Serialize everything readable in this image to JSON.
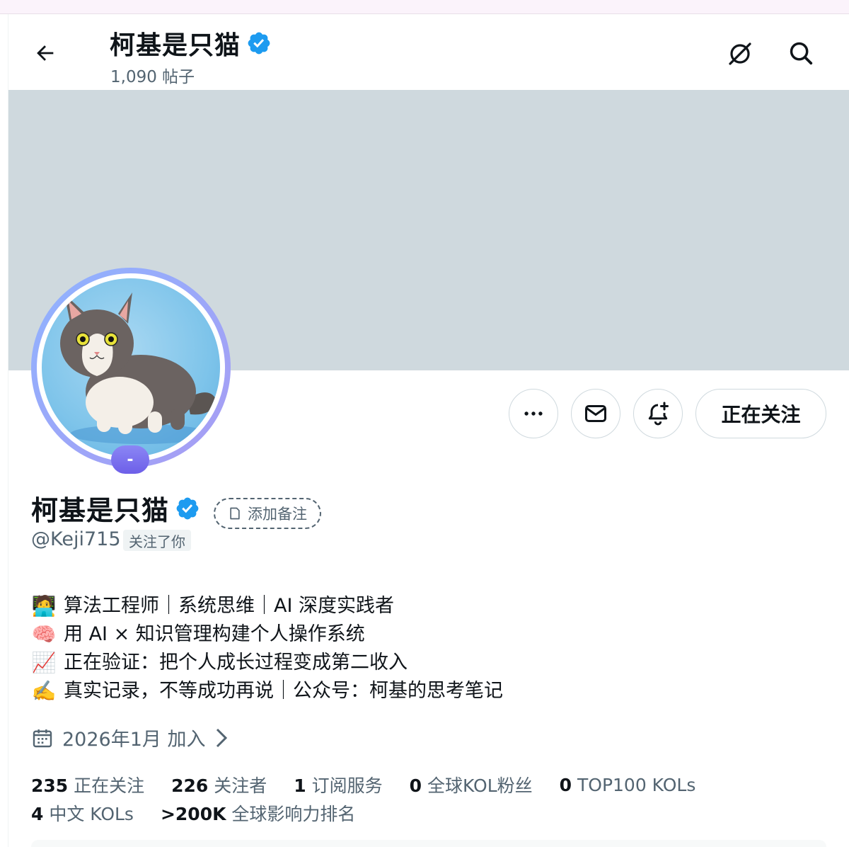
{
  "header": {
    "back_icon": "arrow-left-icon",
    "name": "柯基是只猫",
    "posts": "1,090 帖子",
    "grok_icon": "grok-icon",
    "search_icon": "search-icon"
  },
  "profile": {
    "name": "柯基是只猫",
    "verified_icon": "verified-badge-icon",
    "verified_color": "#1d9bf0",
    "add_note": "添加备注",
    "handle": "@Keji715",
    "follows_you": "关注了你",
    "avatar_badge": "-",
    "accent_color": "#6d5fe8"
  },
  "actions": {
    "more_icon": "more-icon",
    "message_icon": "mail-icon",
    "notify_icon": "bell-plus-icon",
    "follow_label": "正在关注"
  },
  "bio": [
    {
      "emoji": "🧑‍💻",
      "text": "算法工程师｜系统思维｜AI 深度实践者"
    },
    {
      "emoji": "🧠",
      "text": "用 AI × 知识管理构建个人操作系统"
    },
    {
      "emoji": "📈",
      "text": "正在验证：把个人成长过程变成第二收入"
    },
    {
      "emoji": "✍️",
      "text": " 真实记录，不等成功再说｜公众号：柯基的思考笔记"
    }
  ],
  "joined": "2026年1月 加入",
  "stats": [
    {
      "value": "235",
      "label": " 正在关注"
    },
    {
      "value": "226",
      "label": " 关注者"
    },
    {
      "value": "1",
      "label": " 订阅服务"
    },
    {
      "value": "0",
      "label": " 全球KOL粉丝"
    },
    {
      "value": "0",
      "label": " TOP100 KOLs"
    },
    {
      "value": "4",
      "label": " 中文 KOLs"
    },
    {
      "value": ">200K",
      "label": " 全球影响力排名"
    }
  ]
}
